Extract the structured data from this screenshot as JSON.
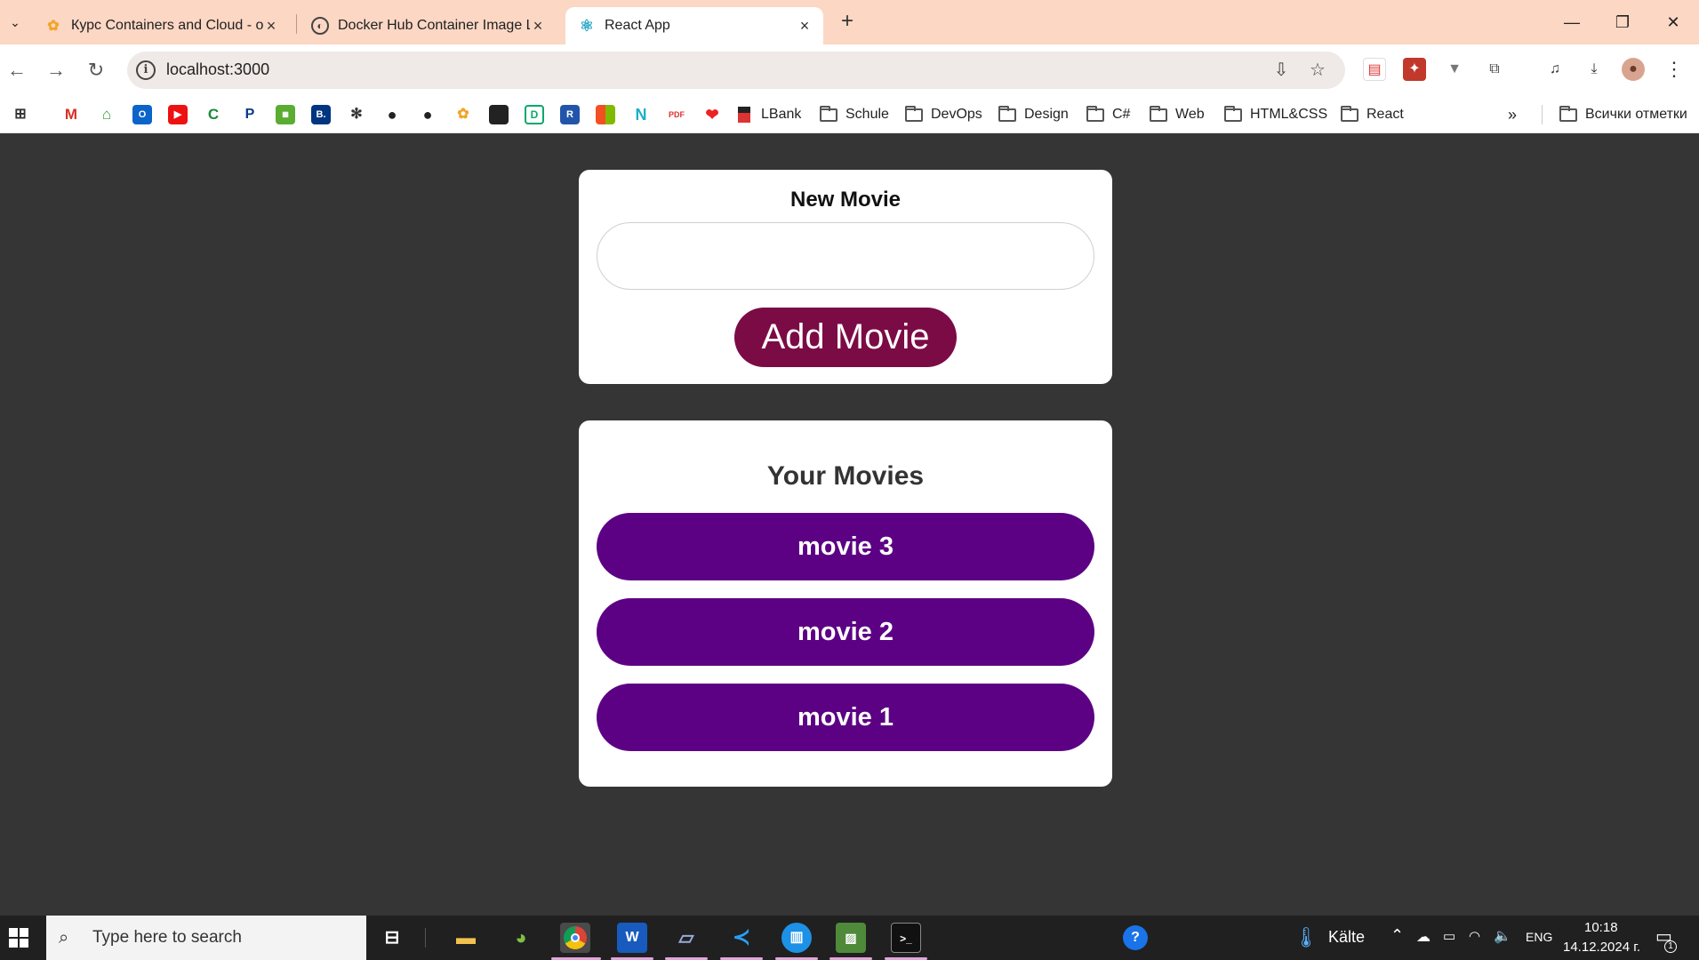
{
  "browser": {
    "tabs": [
      {
        "title": "Курс Containers and Cloud - on",
        "active": false
      },
      {
        "title": "Docker Hub Container Image Li",
        "active": false
      },
      {
        "title": "React App",
        "active": true
      }
    ],
    "url": "localhost:3000",
    "bookmarks": {
      "apps_label": "",
      "items": [
        "LBank",
        "Schule",
        "DevOps",
        "Design",
        "C#",
        "Web",
        "HTML&CSS",
        "React"
      ],
      "all_bookmarks": "Всички отметки"
    }
  },
  "app": {
    "new_movie_title": "New Movie",
    "input_value": "",
    "input_placeholder": "",
    "add_button": "Add Movie",
    "list_title": "Your Movies",
    "movies": [
      "movie 3",
      "movie 2",
      "movie 1"
    ]
  },
  "taskbar": {
    "search_placeholder": "Type here to search",
    "weather": "Kälte",
    "language": "ENG",
    "time": "10:18",
    "date": "14.12.2024 г.",
    "notification_count": "1"
  },
  "colors": {
    "page_bg": "#353535",
    "add_button": "#7b0b45",
    "movie_button": "#5c0184",
    "tabstrip": "#fbd7c4"
  }
}
